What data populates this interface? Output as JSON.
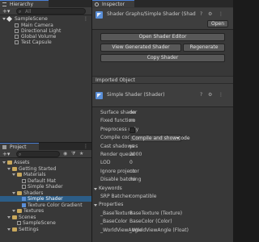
{
  "hierarchy": {
    "tab_label": "Hierarchy",
    "search_placeholder": "All",
    "scene_name": "SampleScene",
    "items": [
      "Main Camera",
      "Directional Light",
      "Global Volume",
      "Test Capsule"
    ]
  },
  "inspector": {
    "tab_label": "Inspector",
    "title": "Shader Graphs/Simple Shader (Shader)",
    "open_label": "Open",
    "open_shader_editor": "Open Shader Editor",
    "view_generated_shader": "View Generated Shader",
    "regenerate": "Regenerate",
    "copy_shader": "Copy Shader",
    "imported_object_label": "Imported Object",
    "imported_title": "Simple Shader (Shader)",
    "properties_rows": [
      {
        "label": "Surface shader",
        "value": "no"
      },
      {
        "label": "Fixed function",
        "value": "no"
      },
      {
        "label": "Preprocess only",
        "value": ""
      },
      {
        "label": "Compile code",
        "value": "Compile and show code"
      },
      {
        "label": "Cast shadows",
        "value": "yes"
      },
      {
        "label": "Render queue",
        "value": "2000"
      },
      {
        "label": "LOD",
        "value": "0"
      },
      {
        "label": "Ignore projector",
        "value": "no"
      },
      {
        "label": "Disable batching",
        "value": "no"
      },
      {
        "label": "Keywords",
        "value": ""
      },
      {
        "label": "SRP Batcher",
        "value": "compatible"
      },
      {
        "label": "Properties",
        "value": ""
      },
      {
        "label": "_BaseTexture",
        "value": "BaseTexture (Texture)"
      },
      {
        "label": "_BaseColor",
        "value": "BaseColor (Color)"
      },
      {
        "label": "_WorldViewAngle",
        "value": "_WorldViewAngle (Float)"
      }
    ]
  },
  "project": {
    "tab_label": "Project",
    "search_placeholder": "",
    "tree": [
      {
        "label": "Assets",
        "indent": 0,
        "kind": "folder"
      },
      {
        "label": "Getting Started",
        "indent": 1,
        "kind": "folder"
      },
      {
        "label": "Materials",
        "indent": 2,
        "kind": "folder"
      },
      {
        "label": "Default Mat",
        "indent": 3,
        "kind": "asset"
      },
      {
        "label": "Simple Shader",
        "indent": 3,
        "kind": "asset"
      },
      {
        "label": "Shaders",
        "indent": 2,
        "kind": "folder"
      },
      {
        "label": "Simple Shader",
        "indent": 3,
        "kind": "shader",
        "selected": true
      },
      {
        "label": "Texture Color Gradient",
        "indent": 3,
        "kind": "shader"
      },
      {
        "label": "Textures",
        "indent": 2,
        "kind": "folder"
      },
      {
        "label": "Scenes",
        "indent": 1,
        "kind": "folder"
      },
      {
        "label": "SampleScene",
        "indent": 2,
        "kind": "asset"
      },
      {
        "label": "Settings",
        "indent": 1,
        "kind": "folder"
      }
    ]
  },
  "colors": {
    "selection": "#2c5d87",
    "accent": "#4a7fd6",
    "panel": "#383838"
  }
}
